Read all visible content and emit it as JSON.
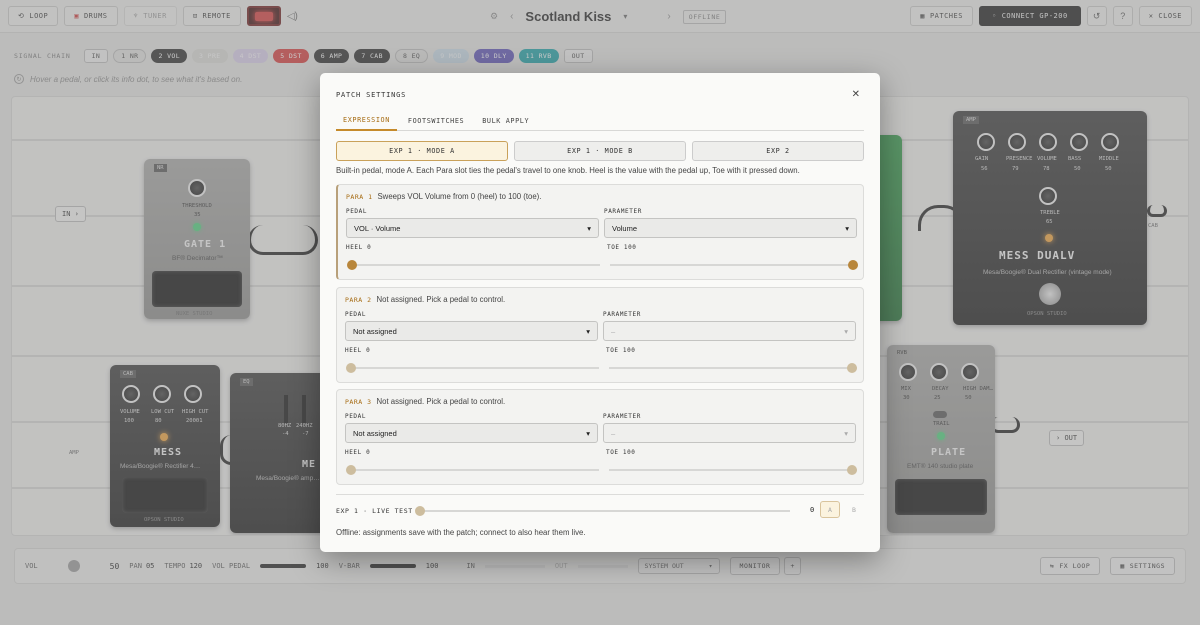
{
  "topbar": {
    "buttons": [
      {
        "label": "LOOP",
        "icon": "loop-icon"
      },
      {
        "label": "DRUMS",
        "icon": "drum-icon"
      },
      {
        "label": "TUNER",
        "icon": "tuner-icon"
      },
      {
        "label": "REMOTE",
        "icon": "remote-icon"
      }
    ],
    "patch_name": "Scotland Kiss",
    "status": "OFFLINE",
    "patches_label": "PATCHES",
    "connect_label": "CONNECT GP-200",
    "close_label": "CLOSE"
  },
  "signal_chain": {
    "label": "SIGNAL CHAIN",
    "blocks": [
      {
        "label": "IN",
        "color": "#eeeeee",
        "style": "rect"
      },
      {
        "label": "1 NR",
        "color": "#e0e0de",
        "style": "pill-light"
      },
      {
        "label": "2 VOL",
        "color": "#2b2b2b",
        "style": "pill"
      },
      {
        "label": "3 PRE",
        "color": "#d9d9d6",
        "style": "pill-ghost"
      },
      {
        "label": "4 DST",
        "color": "#d8cde9",
        "style": "pill-ghost"
      },
      {
        "label": "5 DST",
        "color": "#d63a3a",
        "style": "pill"
      },
      {
        "label": "6 AMP",
        "color": "#2b2b2b",
        "style": "pill"
      },
      {
        "label": "7 CAB",
        "color": "#2b2b2b",
        "style": "pill"
      },
      {
        "label": "8 EQ",
        "color": "#e0e0de",
        "style": "pill-light"
      },
      {
        "label": "9 MOD",
        "color": "#c8dbe8",
        "style": "pill-ghost"
      },
      {
        "label": "10 DLY",
        "color": "#5a4fb5",
        "style": "pill"
      },
      {
        "label": "11 RVB",
        "color": "#1aa1a6",
        "style": "pill"
      },
      {
        "label": "OUT",
        "color": "#eeeeee",
        "style": "rect"
      }
    ]
  },
  "hint": "Hover a pedal, or click its info dot, to see what it's based on.",
  "board": {
    "in_label": "IN",
    "out_label": "OUT",
    "amp_port_label": "AMP",
    "cab_port_label": "CAB",
    "gate": {
      "tag": "NR",
      "name": "GATE 1",
      "sub": "BF® Decimator™",
      "knob_label": "THRESHOLD",
      "knob_value": "35",
      "brand": "NUXE STUDIO"
    },
    "amp": {
      "tag": "AMP",
      "name": "MESS DUALV",
      "sub": "Mesa/Boogie® Dual Rectifier (vintage mode)",
      "brand": "OPSON STUDIO",
      "knobs": [
        {
          "label": "GAIN",
          "value": "56"
        },
        {
          "label": "PRESENCE",
          "value": "79"
        },
        {
          "label": "VOLUME",
          "value": "78"
        },
        {
          "label": "BASS",
          "value": "50"
        },
        {
          "label": "MIDDLE",
          "value": "50"
        }
      ],
      "treble": {
        "label": "TREBLE",
        "value": "65"
      }
    },
    "cab": {
      "tag": "CAB",
      "name": "MESS",
      "sub": "Mesa/Boogie® Rectifier 4…",
      "brand": "OPSON STUDIO",
      "knobs": [
        {
          "label": "VOLUME",
          "value": "100"
        },
        {
          "label": "LOW CUT",
          "value": "80"
        },
        {
          "label": "HIGH CUT",
          "value": "20001"
        }
      ]
    },
    "eq": {
      "tag": "EQ",
      "name": "ME",
      "sub": "Mesa/Boogie® amp…",
      "bands": [
        {
          "label": "80HZ",
          "value": "-4"
        },
        {
          "label": "240HZ",
          "value": "-7"
        }
      ]
    },
    "reverb": {
      "tag": "RVB",
      "name": "PLATE",
      "sub": "EMT® 140 studio plate",
      "knobs": [
        {
          "label": "MIX",
          "value": "30"
        },
        {
          "label": "DECAY",
          "value": "25"
        },
        {
          "label": "HIGH DAM…",
          "value": "50"
        }
      ],
      "trail_label": "TRAIL"
    }
  },
  "bottombar": {
    "vol_label": "VOL",
    "vol_value": "50",
    "pan_label": "PAN",
    "pan_value": "05",
    "tempo_label": "TEMPO",
    "tempo_value": "120",
    "vol_pedal_label": "VOL PEDAL",
    "vol_pedal_value": "100",
    "vol_pedal_fill": 1.0,
    "vbar_label": "V-BAR",
    "vbar_value": "100",
    "vbar_fill": 1.0,
    "in_label": "IN",
    "out_label": "OUT",
    "output_select": "SYSTEM OUT",
    "monitor_label": "MONITOR",
    "fx_loop_label": "FX LOOP",
    "settings_label": "SETTINGS"
  },
  "modal": {
    "title": "PATCH SETTINGS",
    "tabs": [
      "EXPRESSION",
      "FOOTSWITCHES",
      "BULK APPLY"
    ],
    "active_tab": 0,
    "modes": [
      "EXP 1 · MODE A",
      "EXP 1 · MODE B",
      "EXP 2"
    ],
    "active_mode": 0,
    "description": "Built-in pedal, mode A. Each Para slot ties the pedal's travel to one knob. Heel is the value with the pedal up, Toe with it pressed down.",
    "pedal_label": "PEDAL",
    "parameter_label": "PARAMETER",
    "heel_label": "HEEL",
    "toe_label": "TOE",
    "paras": [
      {
        "tag": "PARA 1",
        "summary": "Sweeps VOL Volume from 0 (heel) to 100 (toe).",
        "pedal": "VOL · Volume",
        "parameter": "Volume",
        "heel": "0",
        "toe": "100",
        "heel_frac": 0.0,
        "toe_frac": 1.0,
        "assigned": true
      },
      {
        "tag": "PARA 2",
        "summary": "Not assigned. Pick a pedal to control.",
        "pedal": "Not assigned",
        "parameter": "–",
        "heel": "0",
        "toe": "100",
        "heel_frac": 0.0,
        "toe_frac": 1.0,
        "assigned": false
      },
      {
        "tag": "PARA 3",
        "summary": "Not assigned. Pick a pedal to control.",
        "pedal": "Not assigned",
        "parameter": "–",
        "heel": "0",
        "toe": "100",
        "heel_frac": 0.0,
        "toe_frac": 1.0,
        "assigned": false
      }
    ],
    "live_test_label": "EXP 1 · LIVE TEST",
    "live_test_value": "0",
    "live_test_frac": 0.0,
    "ab": [
      "A",
      "B"
    ],
    "footer": "Offline: assignments save with the patch; connect to also hear them live."
  }
}
